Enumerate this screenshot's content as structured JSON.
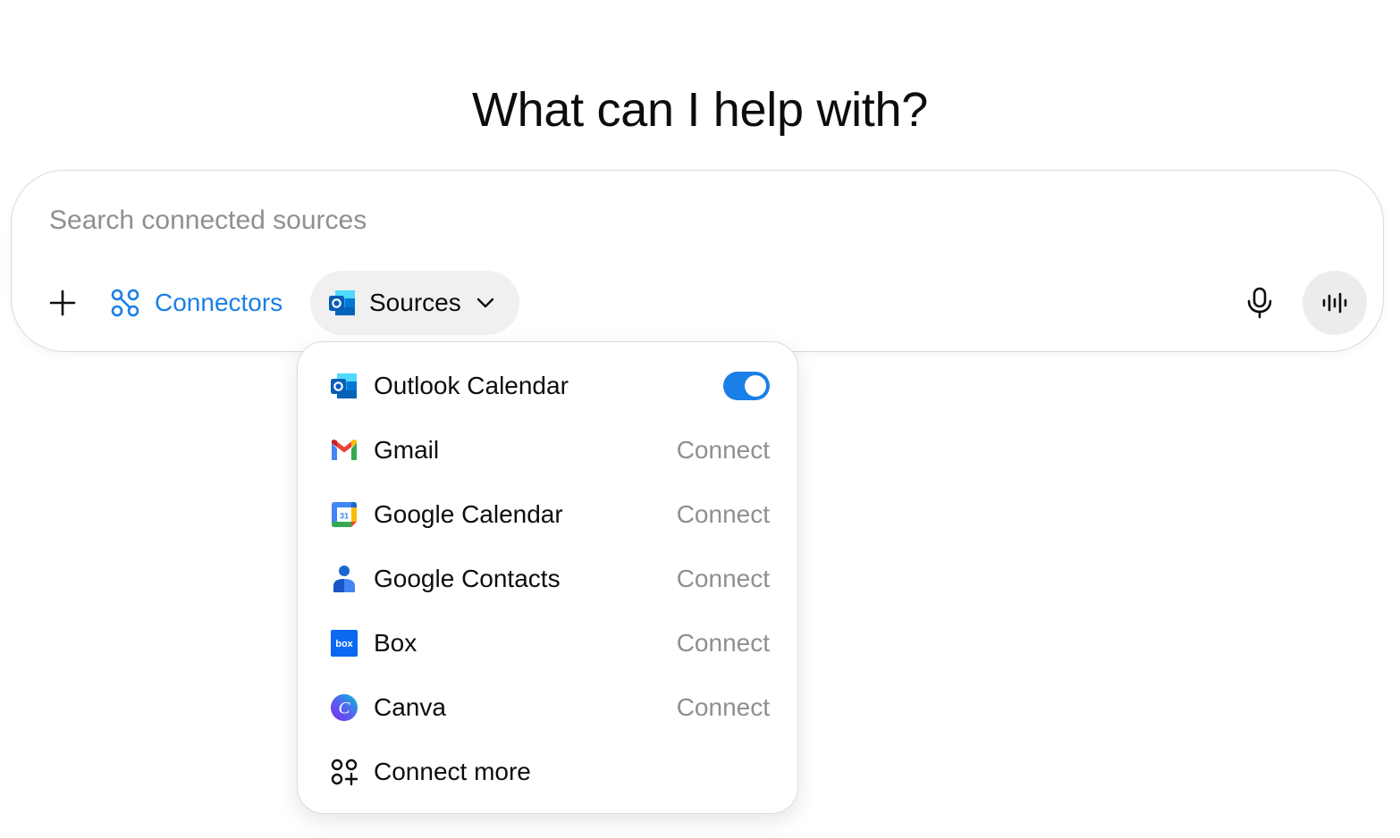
{
  "headline": "What can I help with?",
  "composer": {
    "placeholder": "Search connected sources",
    "connectors_label": "Connectors",
    "sources_label": "Sources",
    "accent_color": "#1a7fe6"
  },
  "sources_menu": {
    "items": [
      {
        "label": "Outlook Calendar",
        "icon": "outlook-icon",
        "enabled": true
      },
      {
        "label": "Gmail",
        "icon": "gmail-icon",
        "action": "Connect"
      },
      {
        "label": "Google Calendar",
        "icon": "google-calendar-icon",
        "action": "Connect",
        "icon_text": "31"
      },
      {
        "label": "Google Contacts",
        "icon": "google-contacts-icon",
        "action": "Connect"
      },
      {
        "label": "Box",
        "icon": "box-icon",
        "action": "Connect",
        "icon_text": "box"
      },
      {
        "label": "Canva",
        "icon": "canva-icon",
        "action": "Connect",
        "icon_text": "C"
      }
    ],
    "connect_more_label": "Connect more"
  }
}
